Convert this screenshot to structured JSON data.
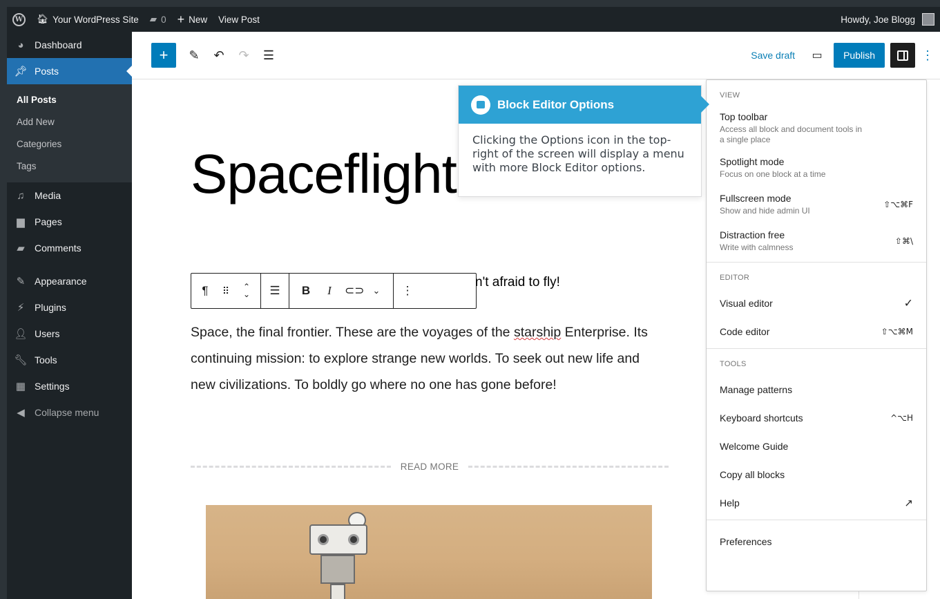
{
  "adminbar": {
    "site_name": "Your WordPress Site",
    "comments_count": "0",
    "new_label": "New",
    "view_post": "View Post",
    "howdy": "Howdy, Joe Blogg"
  },
  "sidebar": {
    "dashboard": "Dashboard",
    "posts": "Posts",
    "posts_sub": [
      "All Posts",
      "Add New",
      "Categories",
      "Tags"
    ],
    "media": "Media",
    "pages": "Pages",
    "comments": "Comments",
    "appearance": "Appearance",
    "plugins": "Plugins",
    "users": "Users",
    "tools": "Tools",
    "settings": "Settings",
    "collapse": "Collapse menu"
  },
  "toolbar": {
    "save_draft": "Save draft",
    "publish": "Publish"
  },
  "content": {
    "title": "Spaceflight",
    "subheading_visible": "n't afraid to fly!",
    "para_pre": "Space, the final frontier. These are the voyages of the ",
    "para_misspelled": "starship",
    "para_post": " Enterprise. Its continuing mission: to explore strange new worlds. To seek out new life and new civilizations. To boldly go where no one has gone before!",
    "read_more": "READ MORE"
  },
  "callout": {
    "title": "Block Editor Options",
    "body": "Clicking the Options icon in the top-right of the screen will display a menu with more Block Editor options."
  },
  "options_menu": {
    "view": {
      "heading": "VIEW",
      "top_toolbar": "Top toolbar",
      "top_toolbar_desc": "Access all block and document tools in a single place",
      "spotlight": "Spotlight mode",
      "spotlight_desc": "Focus on one block at a time",
      "fullscreen": "Fullscreen mode",
      "fullscreen_desc": "Show and hide admin UI",
      "fullscreen_key": "⇧⌥⌘F",
      "distraction": "Distraction free",
      "distraction_desc": "Write with calmness",
      "distraction_key": "⇧⌘\\"
    },
    "editor": {
      "heading": "EDITOR",
      "visual": "Visual editor",
      "visual_check": "✓",
      "code": "Code editor",
      "code_key": "⇧⌥⌘M"
    },
    "tools": {
      "heading": "TOOLS",
      "patterns": "Manage patterns",
      "shortcuts": "Keyboard shortcuts",
      "shortcuts_key": "^⌥H",
      "welcome": "Welcome Guide",
      "copy": "Copy all blocks",
      "help": "Help"
    },
    "preferences": "Preferences"
  }
}
